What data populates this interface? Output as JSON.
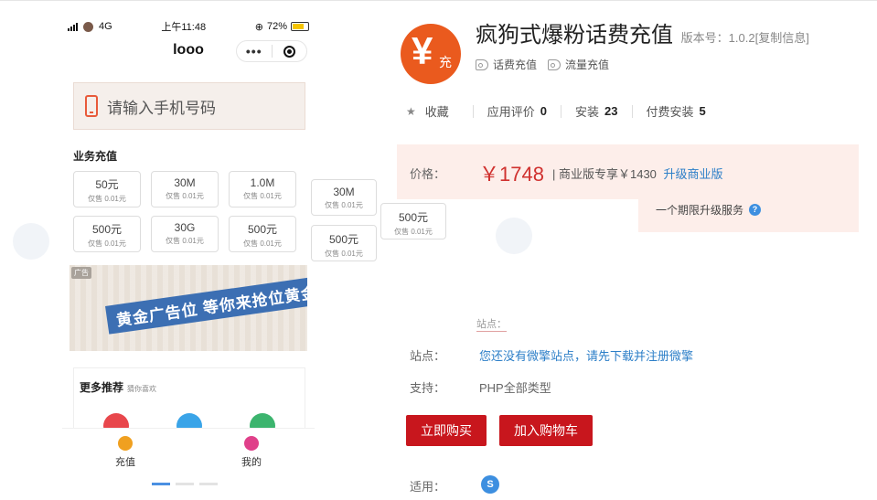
{
  "phone": {
    "status": {
      "network": "4G",
      "time": "上午11:48",
      "battery": "72%"
    },
    "nav_title": "looo",
    "capsule_dots": "•••",
    "input_placeholder": "请输入手机号码",
    "section_title": "业务充值",
    "packages": [
      {
        "name": "50元",
        "price": "仅售 0.01元"
      },
      {
        "name": "30M",
        "price": "仅售 0.01元"
      },
      {
        "name": "1.0M",
        "price": "仅售 0.01元"
      },
      {
        "name": "500元",
        "price": "仅售 0.01元"
      },
      {
        "name": "30G",
        "price": "仅售 0.01元"
      },
      {
        "name": "500元",
        "price": "仅售 0.01元"
      }
    ],
    "floating_packages": [
      {
        "name": "30M",
        "price": "仅售 0.01元"
      },
      {
        "name": "500元",
        "price": "仅售 0.01元"
      },
      {
        "name": "500元",
        "price": "仅售 0.01元"
      }
    ],
    "banner": {
      "ad_label": "广告",
      "text": "黄金广告位 等你来抢位黄金"
    },
    "more": {
      "title": "更多推荐",
      "subtitle": "猜你喜欢"
    },
    "tabs": [
      {
        "label": "充值",
        "color": "#f0a020"
      },
      {
        "label": "我的",
        "color": "#e0408a"
      }
    ]
  },
  "product": {
    "logo_symbol": "¥",
    "logo_tag": "充",
    "title": "疯狗式爆粉话费充值",
    "version": "版本号：1.0.2[复制信息]",
    "tags": [
      "话费充值",
      "流量充值"
    ],
    "stats": [
      {
        "label": "收藏",
        "value": ""
      },
      {
        "label": "应用评价",
        "value": "0"
      },
      {
        "label": "安装",
        "value": "23"
      },
      {
        "label": "付费安装",
        "value": "5"
      }
    ],
    "price_label": "价格：",
    "price": "￥1748",
    "business_price": "| 商业版专享￥1430",
    "upgrade_link": "升级商业版",
    "service_text": "一个期限升级服务",
    "help_icon": "?",
    "site_ghost": "站点：",
    "site_label": "站点：",
    "site_value": "您还没有微擎站点，请先下载并注册微擎",
    "support_label": "支持：",
    "support_value": "PHP全部类型",
    "buy_button": "立即购买",
    "cart_button": "加入购物车",
    "applicable_label": "适用：",
    "accent_color": "#c8161d",
    "link_color": "#2d7fc8",
    "icons": [
      "star-icon",
      "tag-icon",
      "help-icon",
      "miniprogram-icon"
    ]
  }
}
